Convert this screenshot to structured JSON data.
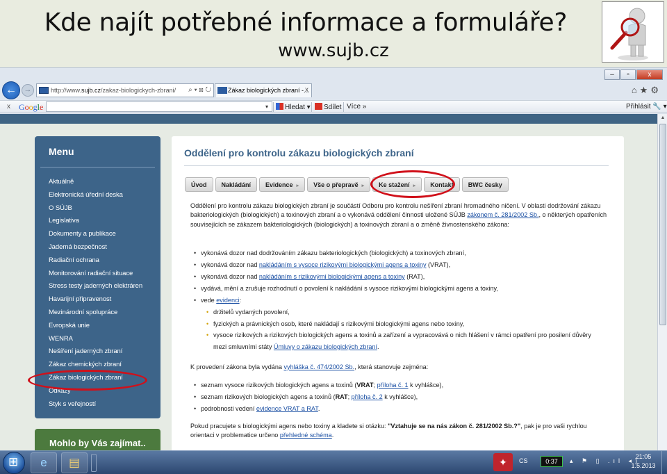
{
  "slide": {
    "title": "Kde najít potřebné informace a formuláře?",
    "subtitle": "www.sujb.cz"
  },
  "browser": {
    "window_controls": [
      "–",
      "▫",
      "x"
    ],
    "back_glyph": "←",
    "forward_glyph": "→",
    "url_prefix": "http://www.",
    "url_host": "sujb.cz",
    "url_path": "/zakaz-biologickych-zbrani/",
    "url_tools": "⌕ ▾ ⊠ ↻",
    "tab_title": "Zákaz biologických zbraní -...",
    "tab_close": "x",
    "nav_icons": "⌂★⚙",
    "google_toolbar": {
      "close": "x",
      "logo_letters": [
        "G",
        "o",
        "o",
        "g",
        "l",
        "e"
      ],
      "dropdown_arrow": "▾",
      "search_value": "",
      "hledat": "Hledat ▾",
      "sdilet": "Sdílet",
      "vice": "Více »",
      "prihlasit": "Přihlásit 🔧 ▾"
    },
    "scroll_up_glyph": "▲"
  },
  "page": {
    "menu": {
      "title": "Menu",
      "items": [
        "Aktuálně",
        "Elektronická úřední deska",
        "O SÚJB",
        "Legislativa",
        "Dokumenty a publikace",
        "Jaderná bezpečnost",
        "Radiační ochrana",
        "Monitorování radiační situace",
        "Stress testy jaderných elektráren",
        "Havarijní připravenost",
        "Mezinárodní spolupráce",
        "Evropská unie",
        "WENRA",
        "Nešíření jaderných zbraní",
        "Zákaz chemických zbraní",
        "Zákaz biologických zbraní",
        "Odkazy",
        "Styk s veřejností"
      ]
    },
    "interest_title": "Mohlo by Vás zajímat..",
    "content": {
      "title": "Oddělení pro kontrolu zákazu biologických zbraní",
      "tabs": [
        {
          "label": "Úvod",
          "arrow": ""
        },
        {
          "label": "Nakládání",
          "arrow": ""
        },
        {
          "label": "Evidence",
          "arrow": "▸"
        },
        {
          "label": "Vše o přepravě",
          "arrow": "▸"
        },
        {
          "label": "Ke stažení",
          "arrow": "▸"
        },
        {
          "label": "Kontakt",
          "arrow": ""
        },
        {
          "label": "BWC česky",
          "arrow": ""
        }
      ],
      "intro": {
        "p1": "Oddělení pro kontrolu zákazu biologických zbraní je součástí Odboru pro kontrolu nešíření zbraní hromadného ničení. V oblasti dodržování zákazu bakteriologických (biologických) a toxinových zbraní a o ",
        "p1_cont": "vykonává oddělení činnosti uložené SÚJB ",
        "link1": "zákonem č. 281/2002 Sb.",
        "p2": ", o některých opatřeních souvisejících se zákazem bakteriologických (biologických) a toxinových zbraní a o změně živnostenského zákona:"
      },
      "bullets": {
        "b1": "vykonává dozor nad dodržováním zákazu bakteriologických (biologických) a toxinových zbraní,",
        "b2_pre": "vykonává dozor nad ",
        "b2_link": "nakládáním s vysoce rizikovými biologickými agens a toxiny",
        "b2_post": " (VRAT),",
        "b3_pre": "vykonává dozor nad ",
        "b3_link": "nakládáním s rizikovými biologickými agens a toxiny",
        "b3_post": " (RAT),",
        "b4": "vydává, mění a zrušuje rozhodnutí o povolení k nakládání s vysoce rizikovými biologickými agens a toxiny,",
        "b5_pre": "vede ",
        "b5_link": "evidenci",
        "b5_post": ":"
      },
      "sub_bullets": {
        "s1": "držitelů vydaných povolení,",
        "s2": "fyzických a právnických osob, které nakládají s rizikovými biologickými agens nebo toxiny,",
        "s3": "vysoce rizikových a rizikových biologických agens a toxinů a zařízení a vypracovává o nich hlášení v rámci opatření pro posilení důvěry mezi smluvními státy ",
        "s3_link": "Úmluvy o zákazu biologických zbraní",
        "s3_post": "."
      },
      "decree": {
        "pre": "K provedení zákona byla vydána ",
        "link": "vyhláška č. 474/2002 Sb.",
        "post": ", která stanovuje zejména:"
      },
      "decree_bullets": {
        "d1_pre": "seznam vysoce rizikových biologických agens a toxinů (",
        "d1_bold": "VRAT",
        "d1_mid": "; ",
        "d1_link": "příloha č. 1",
        "d1_post": " k vyhlášce),",
        "d2_pre": "seznam rizikových biologických agens a toxinů (",
        "d2_bold": "RAT",
        "d2_mid": "; ",
        "d2_link": "příloha č. 2",
        "d2_post": " k vyhlášce),",
        "d3_pre": "podrobnosti vedení ",
        "d3_link": "evidence VRAT a RAT",
        "d3_post": "."
      },
      "closing": {
        "pre": "Pokud pracujete s biologickými agens nebo toxiny a kladete si otázku: ",
        "bold": "\"Vztahuje se na nás zákon č. 281/2002 Sb.?\"",
        "post": ", pak je pro vaši rychlou orientaci v problematice určeno ",
        "link": "přehledné schéma",
        "end": "."
      }
    }
  },
  "taskbar": {
    "ie_glyph": "e",
    "files_glyph": "▤",
    "app_glyph": "✦",
    "lang": "CS",
    "timer": "0:37",
    "tray_icons": "▴ ⚑ ▯ .ıl ◂)",
    "time": "21:05",
    "date": "1.5.2013"
  },
  "colors": {
    "menu_panel": "#3d6489",
    "interest_panel": "#4c7a3e",
    "content_title": "#3d6489",
    "link": "#1a4fa3",
    "highlight_oval": "#d0101a"
  }
}
